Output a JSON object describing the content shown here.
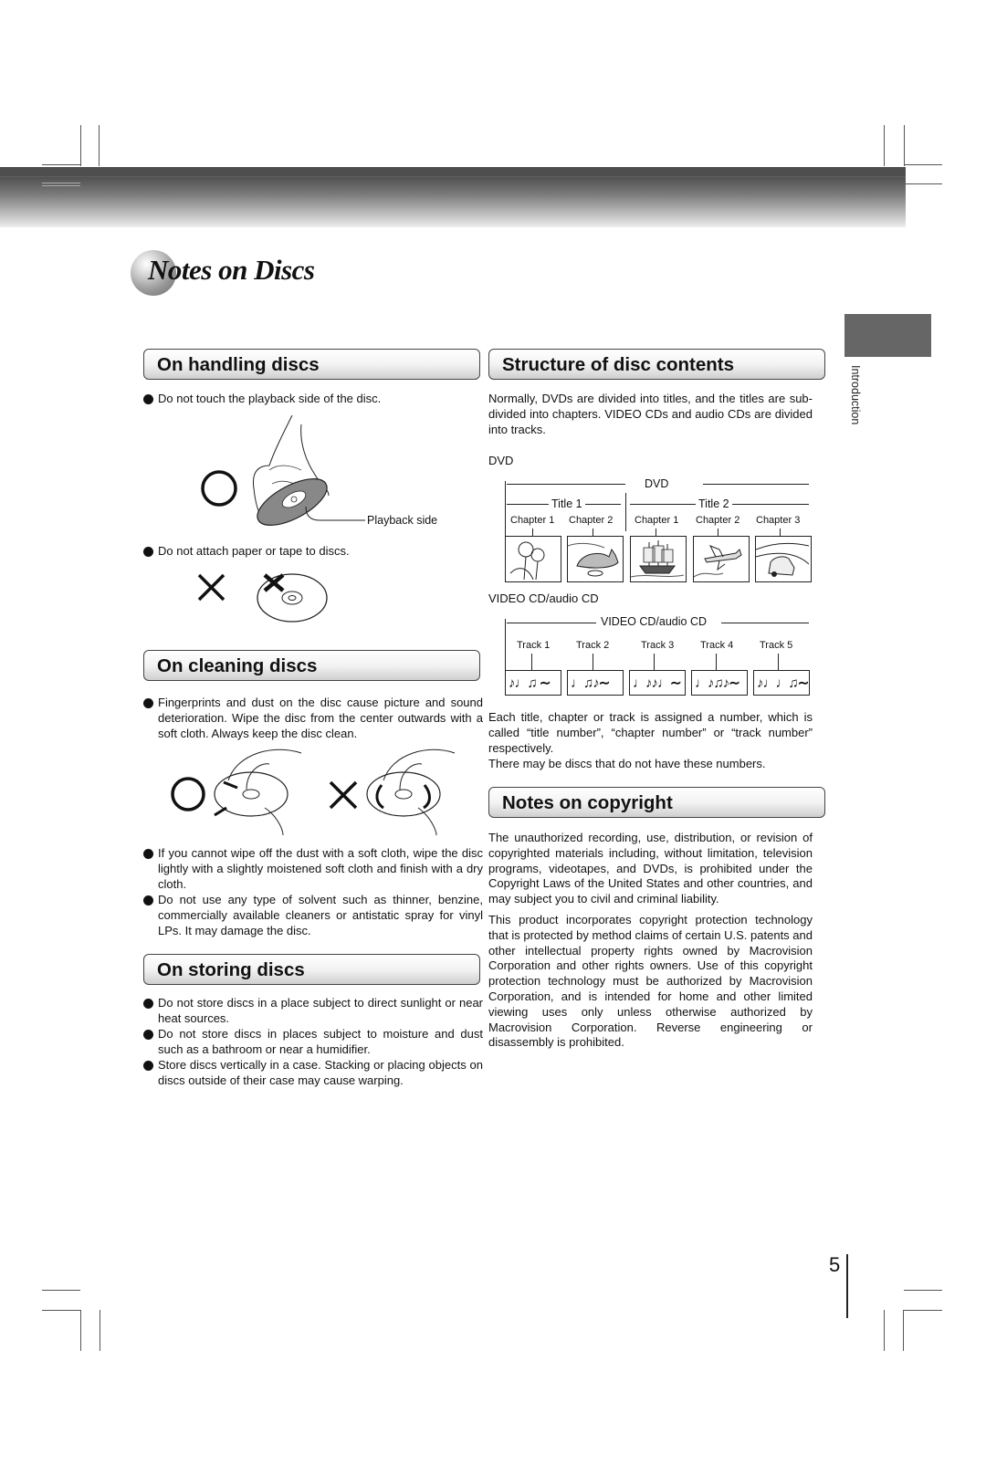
{
  "page": {
    "title": "Notes on Discs",
    "side_tab_label": "Introduction",
    "page_number": "5"
  },
  "handling": {
    "heading": "On handling discs",
    "bullet1": "Do not touch the playback side of the disc.",
    "playback_label": "Playback side",
    "bullet2": "Do not attach paper or tape to discs."
  },
  "cleaning": {
    "heading": "On cleaning discs",
    "bullet1": "Fingerprints and dust on the disc cause picture and sound deterioration. Wipe the disc from the center outwards with a soft cloth. Always keep the disc clean.",
    "bullet2": "If you cannot wipe off the dust with a soft cloth, wipe the disc lightly with a slightly moistened soft cloth and finish with a dry cloth.",
    "bullet3": "Do not use any type of solvent such as thinner, benzine, commercially available cleaners or antistatic spray for vinyl LPs. It may damage the disc."
  },
  "storing": {
    "heading": "On storing discs",
    "bullet1": "Do not store discs in a place subject to direct sunlight or near heat sources.",
    "bullet2": "Do not store discs in places subject to moisture and dust such as a bathroom or near a humidifier.",
    "bullet3": "Store discs vertically in a case. Stacking or placing objects on discs outside of their case may cause warping."
  },
  "structure": {
    "heading": "Structure of disc contents",
    "intro": "Normally, DVDs are divided into titles, and the titles are sub-divided into chapters. VIDEO CDs and audio CDs are divided into tracks.",
    "dvd_label": "DVD",
    "dvd_diagram": {
      "span_label": "DVD",
      "titles": [
        "Title 1",
        "Title 2"
      ],
      "chapters": [
        "Chapter 1",
        "Chapter 2",
        "Chapter 1",
        "Chapter 2",
        "Chapter 3"
      ],
      "images": [
        "flowers-icon",
        "cat-icon",
        "ship-icon",
        "airplane-icon",
        "car-icon"
      ]
    },
    "vcd_label": "VIDEO CD/audio CD",
    "vcd_diagram": {
      "span_label": "VIDEO CD/audio CD",
      "tracks": [
        "Track 1",
        "Track 2",
        "Track 3",
        "Track 4",
        "Track 5"
      ],
      "notes": [
        "♪♩♫ ∼",
        "♩♫♪∼",
        "♩♪♪♩∼",
        "♩♪♫♪∼",
        "♪♩♩♫∼"
      ]
    },
    "outro1": "Each title, chapter or track is assigned a number, which is called “title number”, “chapter number” or “track number” respectively.",
    "outro2": "There may be discs that do not have these numbers."
  },
  "copyright": {
    "heading": "Notes on copyright",
    "para1": "The unauthorized recording, use, distribution, or revision of copyrighted materials including, without limitation, television programs, videotapes, and DVDs, is prohibited under the Copyright Laws of the United States and other countries, and may subject you to civil and criminal liability.",
    "para2": "This product incorporates copyright protection technology that is protected by method claims of certain U.S. patents and other intellectual property rights owned by Macrovision Corporation and other rights owners. Use of this copyright protection technology must be authorized by Macrovision Corporation, and is intended for home and other limited viewing uses only unless otherwise authorized by Macrovision Corporation. Reverse engineering or disassembly is prohibited."
  }
}
